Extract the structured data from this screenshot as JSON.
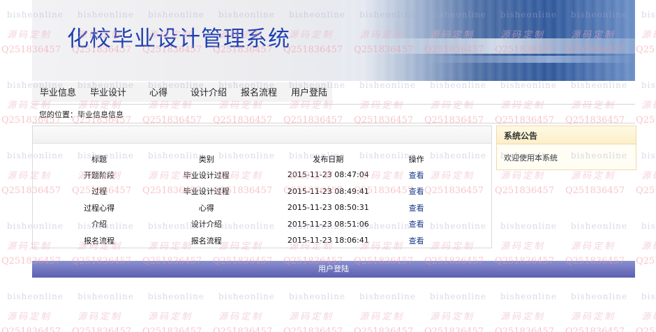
{
  "banner": {
    "title": "化校毕业设计管理系统"
  },
  "nav": {
    "items": [
      {
        "label": "毕业信息"
      },
      {
        "label": "毕业设计"
      },
      {
        "label": "心得"
      },
      {
        "label": "设计介绍"
      },
      {
        "label": "报名流程"
      },
      {
        "label": "用户登陆"
      }
    ]
  },
  "breadcrumb": {
    "label": "您的位置：毕业信息信息"
  },
  "table": {
    "headers": {
      "title": "标题",
      "category": "类别",
      "date": "发布日期",
      "action": "操作"
    },
    "rows": [
      {
        "title": "开题阶段",
        "category": "毕业设计过程",
        "date": "2015-11-23 08:47:04",
        "action": "查看"
      },
      {
        "title": "过程",
        "category": "毕业设计过程",
        "date": "2015-11-23 08:49:41",
        "action": "查看"
      },
      {
        "title": "过程心得",
        "category": "心得",
        "date": "2015-11-23 08:50:31",
        "action": "查看"
      },
      {
        "title": "介绍",
        "category": "设计介绍",
        "date": "2015-11-23 08:51:06",
        "action": "查看"
      },
      {
        "title": "报名流程",
        "category": "报名流程",
        "date": "2015-11-23 18:06:41",
        "action": "查看"
      }
    ]
  },
  "notice": {
    "title": "系统公告",
    "body": "欢迎使用本系统"
  },
  "footer": {
    "link": "用户登陆"
  },
  "watermark": {
    "site": "bisheonline",
    "slogan": "源码定制",
    "qq": "Q2518364​57"
  },
  "colors": {
    "title_blue": "#2040b0",
    "link_blue": "#1a3a8a",
    "footer_bar": "#6e73c0",
    "notice_border": "#f1d9a8"
  }
}
